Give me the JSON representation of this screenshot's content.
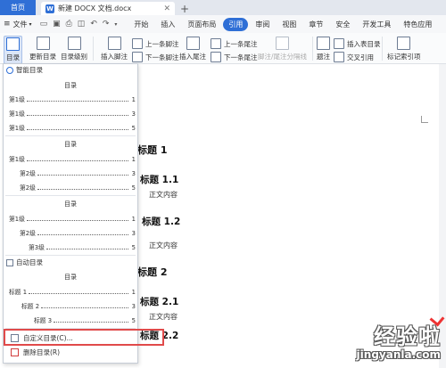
{
  "titlebar": {
    "home_tab": "首页",
    "doc_tab": "新建 DOCX 文档.docx",
    "doc_icon": "W"
  },
  "menubar": {
    "file": "文件",
    "tabs": [
      "开始",
      "插入",
      "页面布局",
      "引用",
      "审阅",
      "视图",
      "章节",
      "安全",
      "开发工具",
      "特色应用"
    ],
    "active_tab": "引用"
  },
  "ribbon": {
    "toc": "目录",
    "update_toc": "更新目录",
    "toc_level": "目录级别",
    "insert_footnote": "插入脚注",
    "prev_footnote": "上一条脚注",
    "next_footnote": "下一条脚注",
    "insert_endnote": "插入尾注",
    "prev_endnote": "上一条尾注",
    "next_endnote": "下一条尾注",
    "footnote_sep": "脚注/尾注分隔线",
    "caption": "题注",
    "insert_table_of_figures": "插入表目录",
    "cross_ref": "交叉引用",
    "mark_index": "标记索引项"
  },
  "dropdown": {
    "smart_toc": "智能目录",
    "auto_toc": "自动目录",
    "toc_heading": "目录",
    "block1": [
      {
        "label": "第1级",
        "page": "1"
      },
      {
        "label": "第1级",
        "page": "3"
      },
      {
        "label": "第1级",
        "page": "5"
      }
    ],
    "block2": [
      {
        "label": "第1级",
        "page": "1"
      },
      {
        "label": "第2级",
        "page": "3"
      },
      {
        "label": "第2级",
        "page": "5"
      }
    ],
    "block3": [
      {
        "label": "第1级",
        "page": "1"
      },
      {
        "label": "第2级",
        "page": "3"
      },
      {
        "label": "第3级",
        "page": "5"
      }
    ],
    "block4": [
      {
        "label": "标题 1",
        "page": "1"
      },
      {
        "label": "标题 2",
        "page": "3"
      },
      {
        "label": "标题 3",
        "page": "5"
      }
    ],
    "custom_toc": "自定义目录(C)...",
    "delete_toc": "删除目录(R)"
  },
  "document": {
    "h1_a": "标题 1",
    "h2_a": "标题 1.1",
    "body_a": "正文内容",
    "h2_b": "标题 1.2",
    "body_b": "正文内容",
    "h1_b": "标题 2",
    "h2_c": "标题 2.1",
    "body_c": "正文内容",
    "h2_d": "标题 2.2"
  },
  "watermark": {
    "logo": "经验啦",
    "url": "jingyanla.com"
  },
  "colors": {
    "accent": "#2f6fd6",
    "highlight": "#e04a4a"
  }
}
